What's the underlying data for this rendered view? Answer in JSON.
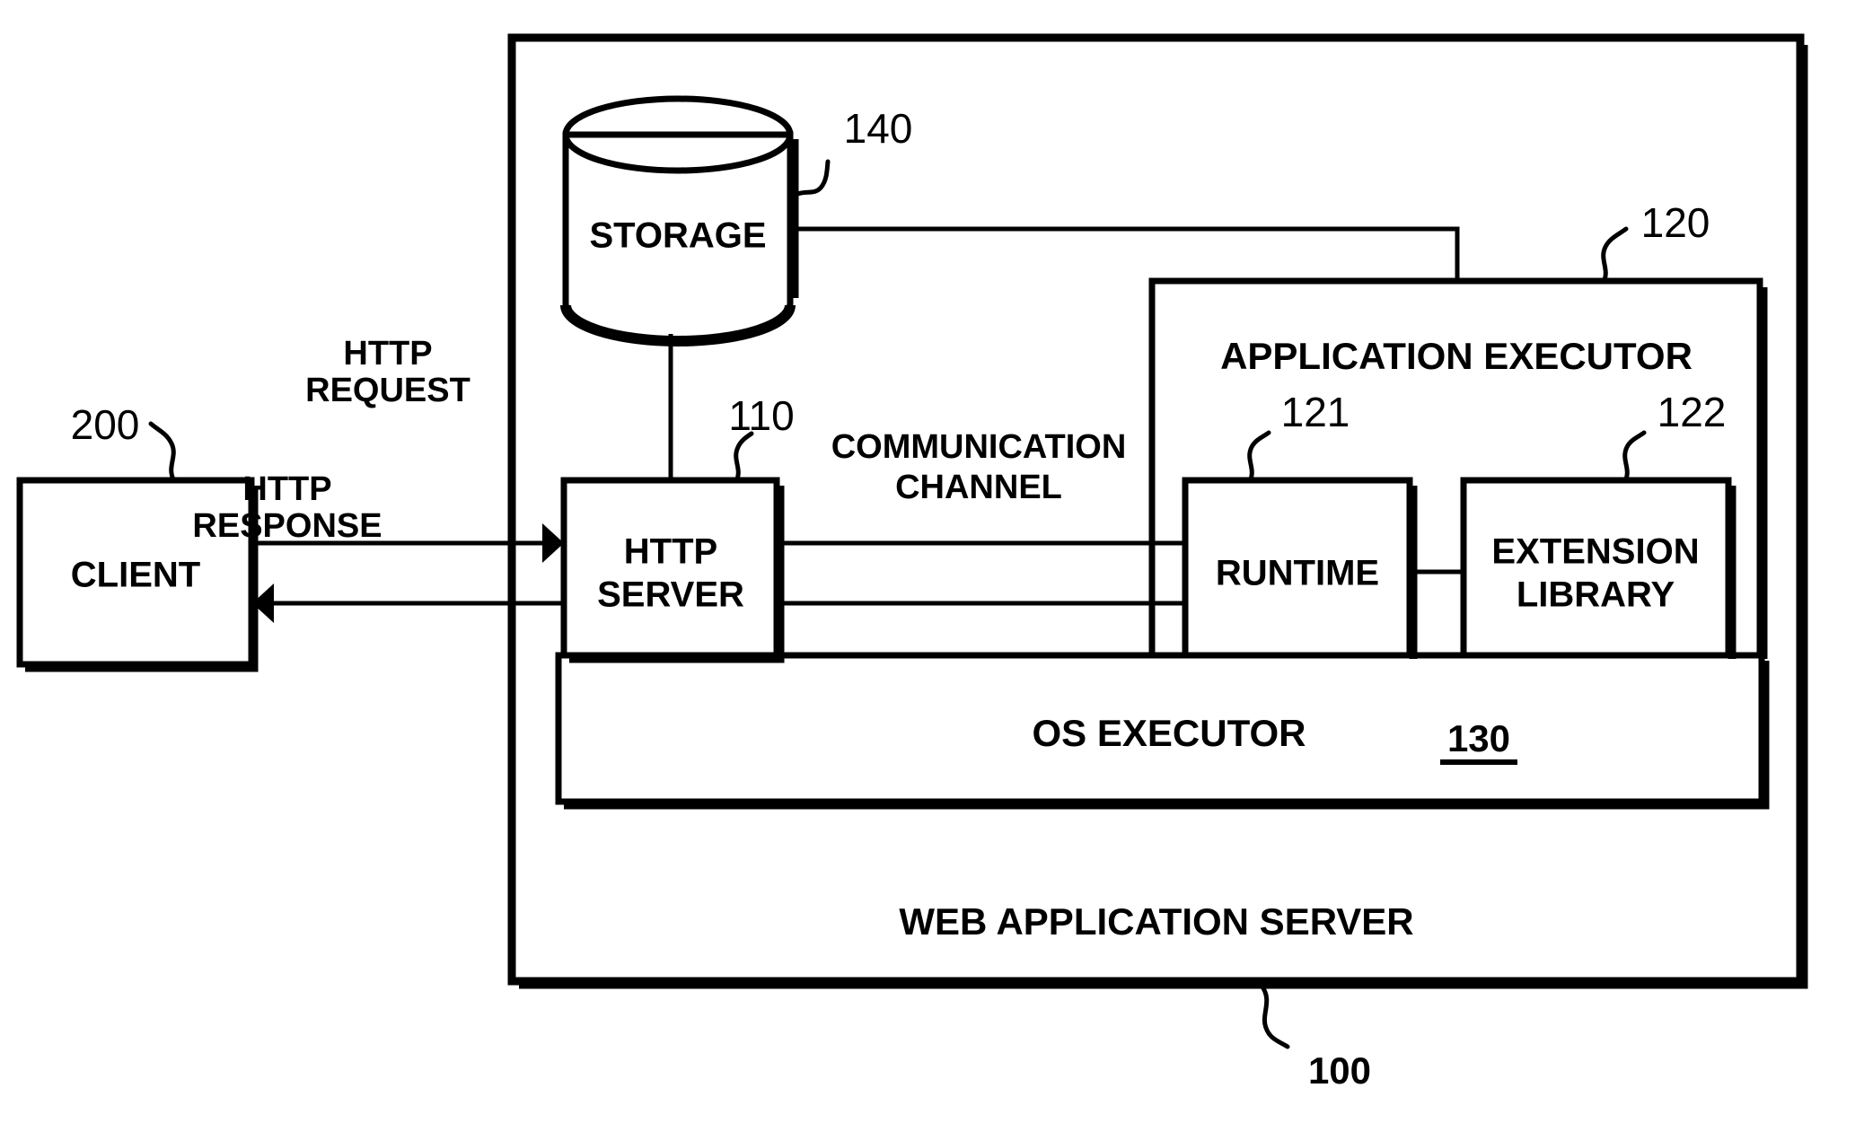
{
  "figure": {
    "type": "patent-block-diagram",
    "background_color": "#ffffff",
    "line_color": "#000000"
  },
  "nodes": {
    "client": {
      "label": "CLIENT",
      "ref": "200"
    },
    "storage": {
      "label": "STORAGE",
      "ref": "140"
    },
    "http_server": {
      "label_line1": "HTTP",
      "label_line2": "SERVER",
      "ref": "110"
    },
    "application_executor": {
      "label": "APPLICATION EXECUTOR",
      "ref": "120"
    },
    "runtime": {
      "label": "RUNTIME",
      "ref": "121"
    },
    "extension_library": {
      "label_line1": "EXTENSION",
      "label_line2": "LIBRARY",
      "ref": "122"
    },
    "os_executor": {
      "label": "OS EXECUTOR",
      "ref": "130"
    },
    "web_application_server": {
      "label": "WEB APPLICATION SERVER",
      "ref": "100"
    }
  },
  "connectors": {
    "http_request": {
      "label_line1": "HTTP",
      "label_line2": "REQUEST",
      "direction": "client-to-server"
    },
    "http_response": {
      "label_line1": "HTTP",
      "label_line2": "RESPONSE",
      "direction": "server-to-client"
    },
    "communication_channel": {
      "label_line1": "COMMUNICATION",
      "label_line2": "CHANNEL"
    }
  }
}
